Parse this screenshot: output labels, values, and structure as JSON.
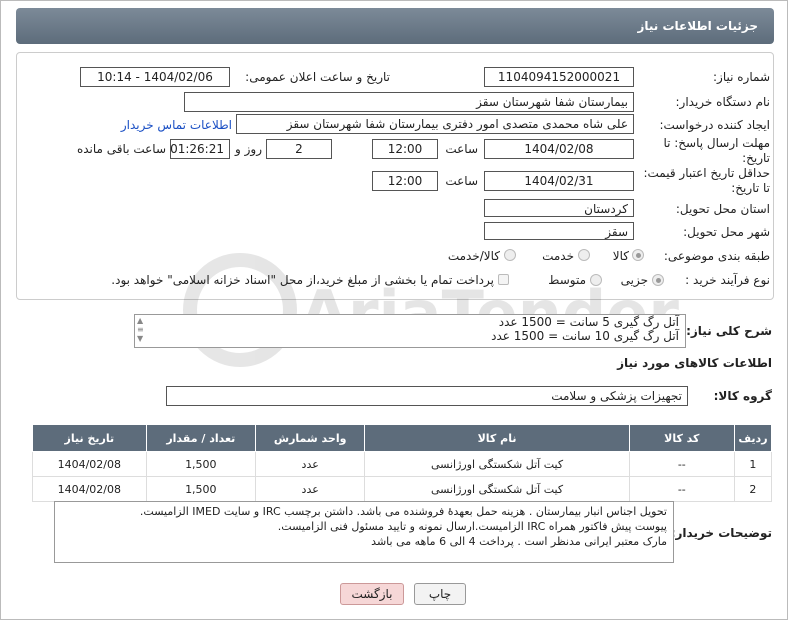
{
  "header": {
    "title": "جزئیات اطلاعات نیاز"
  },
  "fields": {
    "need_number": {
      "label": "شماره نیاز:",
      "value": "1104094152000021"
    },
    "announce_datetime": {
      "label": "تاریخ و ساعت اعلان عمومی:",
      "value": "1404/02/06 - 10:14"
    },
    "buyer_org": {
      "label": "نام دستگاه خریدار:",
      "value": "بیمارستان شفا شهرستان سقز"
    },
    "requester": {
      "label": "ایجاد کننده درخواست:",
      "value": "علی شاه محمدی متصدی امور دفتری بیمارستان شفا شهرستان سقز",
      "contact_link": "اطلاعات تماس خریدار"
    },
    "reply_deadline": {
      "label": "مهلت ارسال پاسخ: تا تاریخ:",
      "date": "1404/02/08",
      "time_label": "ساعت",
      "time": "12:00",
      "days": "2",
      "days_label": "روز و",
      "remaining": "01:26:21",
      "remaining_label": "ساعت باقی مانده"
    },
    "price_validity": {
      "label": "حداقل تاریخ اعتبار قیمت: تا تاریخ:",
      "date": "1404/02/31",
      "time_label": "ساعت",
      "time": "12:00"
    },
    "province": {
      "label": "استان محل تحویل:",
      "value": "کردستان"
    },
    "city": {
      "label": "شهر محل تحویل:",
      "value": "سقز"
    },
    "category": {
      "label": "طبقه بندی موضوعی:",
      "options": [
        "کالا",
        "خدمت",
        "کالا/خدمت"
      ]
    },
    "process_type": {
      "label": "نوع فرآیند خرید :",
      "options": [
        "جزیی",
        "متوسط"
      ],
      "payment_note": "پرداخت تمام یا بخشی از مبلغ خرید،از محل \"اسناد خزانه اسلامی\" خواهد بود."
    }
  },
  "description": {
    "label": "شرح کلی نیاز:",
    "lines": [
      "آتل رگ گیری 5 سانت = 1500 عدد",
      "آتل رگ گیری 10 سانت = 1500 عدد"
    ]
  },
  "goods_info": {
    "title": "اطلاعات کالاهای مورد نیاز",
    "group_label": "گروه کالا:",
    "group_value": "تجهیزات پزشکی و سلامت",
    "columns": [
      "ردیف",
      "کد کالا",
      "نام کالا",
      "واحد شمارش",
      "تعداد / مقدار",
      "تاریخ نیاز"
    ],
    "rows": [
      [
        "1",
        "--",
        "کیت آتل شکستگی اورژانسی",
        "عدد",
        "1,500",
        "1404/02/08"
      ],
      [
        "2",
        "--",
        "کیت آتل شکستگی اورژانسی",
        "عدد",
        "1,500",
        "1404/02/08"
      ]
    ]
  },
  "buyer_notes": {
    "label": "توضیحات خریدار:",
    "lines": [
      "تحویل اجناس  انبار بیمارستان . هزینه حمل بعهدهٔ فروشنده می باشد.  داشتن برچسب IRC  و سایت  IMED  الزامیست.",
      "پیوست پیش فاکتور همراه IRC  الزامیست.ارسال نمونه و تایید مسئول فنی الزامیست.",
      "مارک معتبر ایرانی مدنظر است . پرداخت 4 الی 6 ماهه می باشد"
    ]
  },
  "buttons": {
    "print": "چاپ",
    "back": "بازگشت"
  },
  "watermark": "AriaTender.neT",
  "colors": {
    "header": "#5d6c7b",
    "link": "#1a4fc4",
    "back_button": "#f6d7d7"
  }
}
